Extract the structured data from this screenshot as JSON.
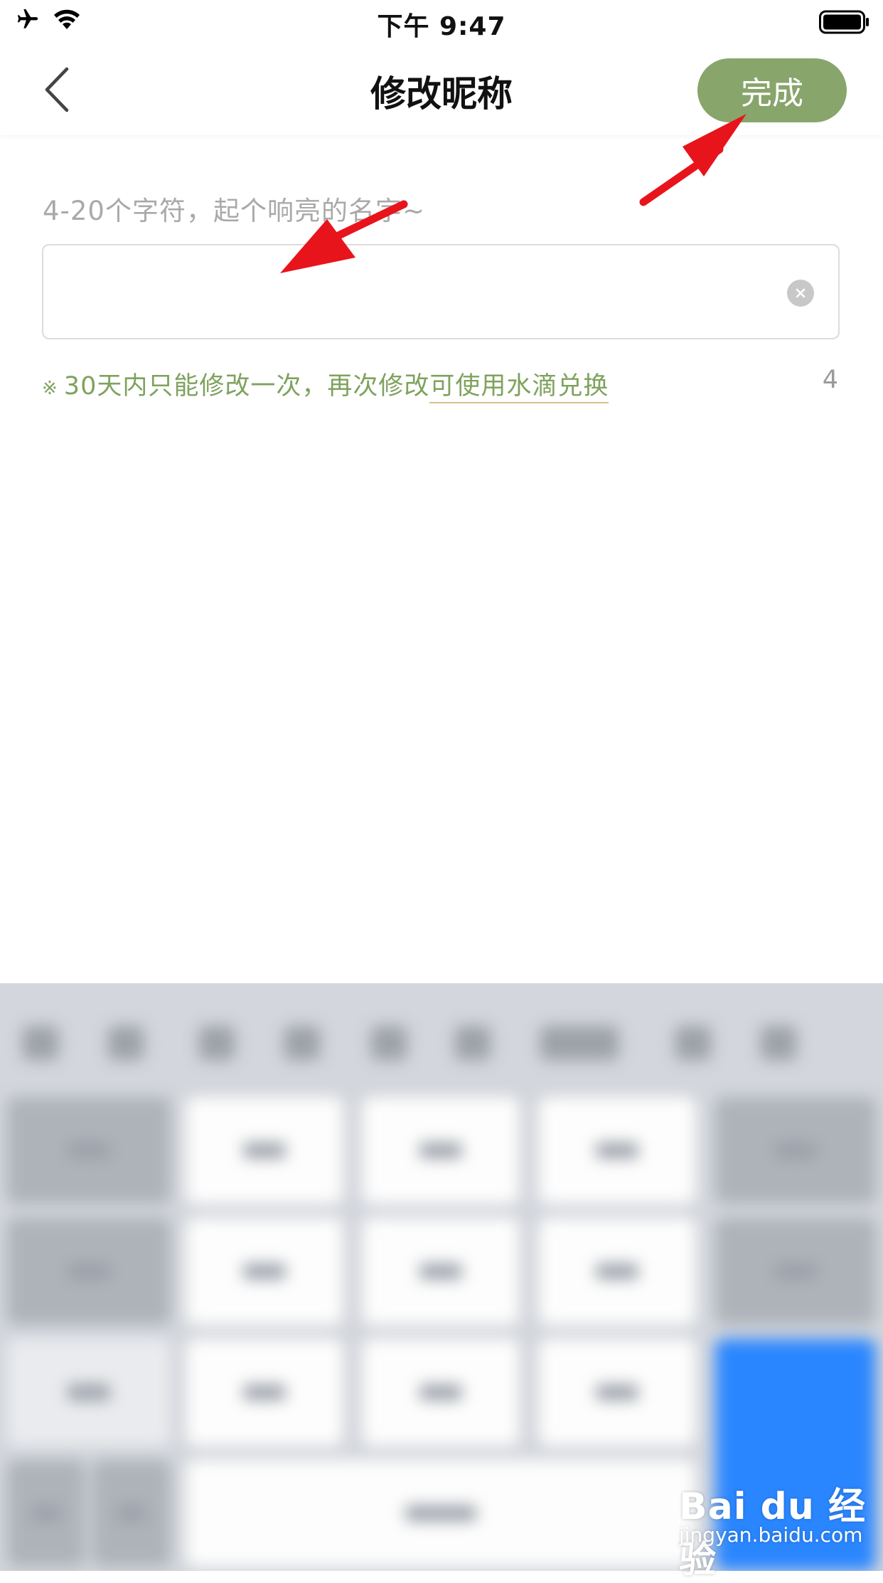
{
  "status_bar": {
    "time": "下午 9:47",
    "icons": [
      "airplane-icon",
      "wifi-icon",
      "battery-icon"
    ]
  },
  "nav": {
    "title": "修改昵称",
    "back_icon": "chevron-left-icon",
    "done_label": "完成",
    "done_color": "#88a56b"
  },
  "form": {
    "hint": "4-20个字符，起个响亮的名字~",
    "nickname_value": "",
    "clear_icon": "clear-circle-icon",
    "notice_mark": "※",
    "notice_text": "30天内只能修改一次，再次修改",
    "notice_link": "可使用水滴兑换",
    "char_count": "4",
    "accent_color": "#7fa25d"
  },
  "annotations": {
    "arrow_color": "#e8141b"
  },
  "watermark": {
    "logo": "Bai du 经验",
    "url": "jingyan.baidu.com"
  }
}
